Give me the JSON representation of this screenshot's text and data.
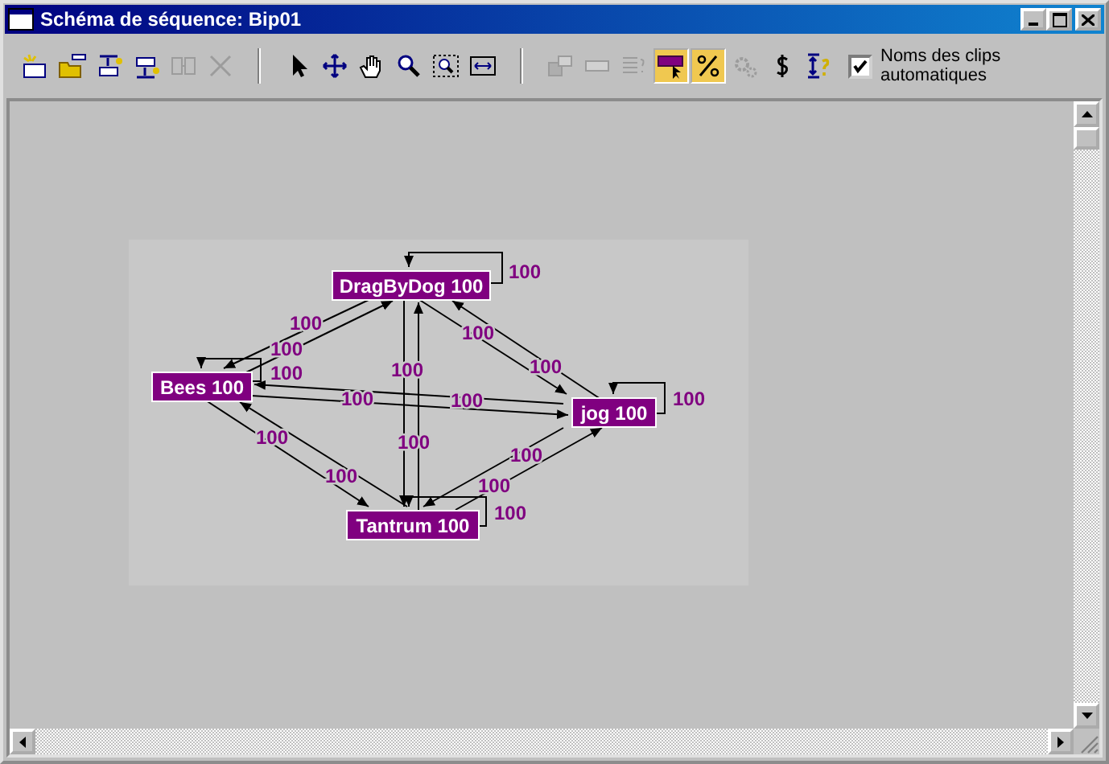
{
  "window": {
    "title": "Schéma de séquence: Bip01"
  },
  "toolbar": {
    "groups": [
      [
        {
          "kind": "new",
          "pressed": false,
          "disabled": false
        },
        {
          "kind": "open",
          "pressed": false,
          "disabled": false
        },
        {
          "kind": "insert-up",
          "pressed": false,
          "disabled": false
        },
        {
          "kind": "insert-down",
          "pressed": false,
          "disabled": false
        },
        {
          "kind": "split",
          "pressed": false,
          "disabled": true
        },
        {
          "kind": "delete",
          "pressed": false,
          "disabled": true
        }
      ],
      [
        {
          "kind": "select",
          "pressed": false,
          "disabled": false
        },
        {
          "kind": "move",
          "pressed": false,
          "disabled": false
        },
        {
          "kind": "pan",
          "pressed": false,
          "disabled": false
        },
        {
          "kind": "zoom",
          "pressed": false,
          "disabled": false
        },
        {
          "kind": "zoom-region",
          "pressed": false,
          "disabled": false
        },
        {
          "kind": "fit",
          "pressed": false,
          "disabled": false
        }
      ],
      [
        {
          "kind": "stack",
          "pressed": false,
          "disabled": true
        },
        {
          "kind": "bar",
          "pressed": false,
          "disabled": true
        },
        {
          "kind": "list",
          "pressed": false,
          "disabled": true
        },
        {
          "kind": "highlight",
          "pressed": true,
          "disabled": false
        },
        {
          "kind": "percent",
          "pressed": true,
          "disabled": false
        },
        {
          "kind": "gear",
          "pressed": false,
          "disabled": true
        },
        {
          "kind": "dollar",
          "pressed": false,
          "disabled": false
        },
        {
          "kind": "info",
          "pressed": false,
          "disabled": false
        }
      ]
    ],
    "checkbox": {
      "label": "Noms des clips automatiques",
      "checked": true
    }
  },
  "diagram": {
    "nodes": [
      {
        "label": "DragByDog 100"
      },
      {
        "label": "Bees 100"
      },
      {
        "label": "jog 100"
      },
      {
        "label": "Tantrum 100"
      }
    ],
    "edges": [
      {
        "label": "100"
      },
      {
        "label": "100"
      },
      {
        "label": "100"
      },
      {
        "label": "100"
      },
      {
        "label": "100"
      },
      {
        "label": "100"
      },
      {
        "label": "100"
      },
      {
        "label": "100"
      },
      {
        "label": "100"
      },
      {
        "label": "100"
      },
      {
        "label": "100"
      },
      {
        "label": "100"
      },
      {
        "label": "100"
      },
      {
        "label": "100"
      },
      {
        "label": "100"
      },
      {
        "label": "100"
      }
    ]
  }
}
